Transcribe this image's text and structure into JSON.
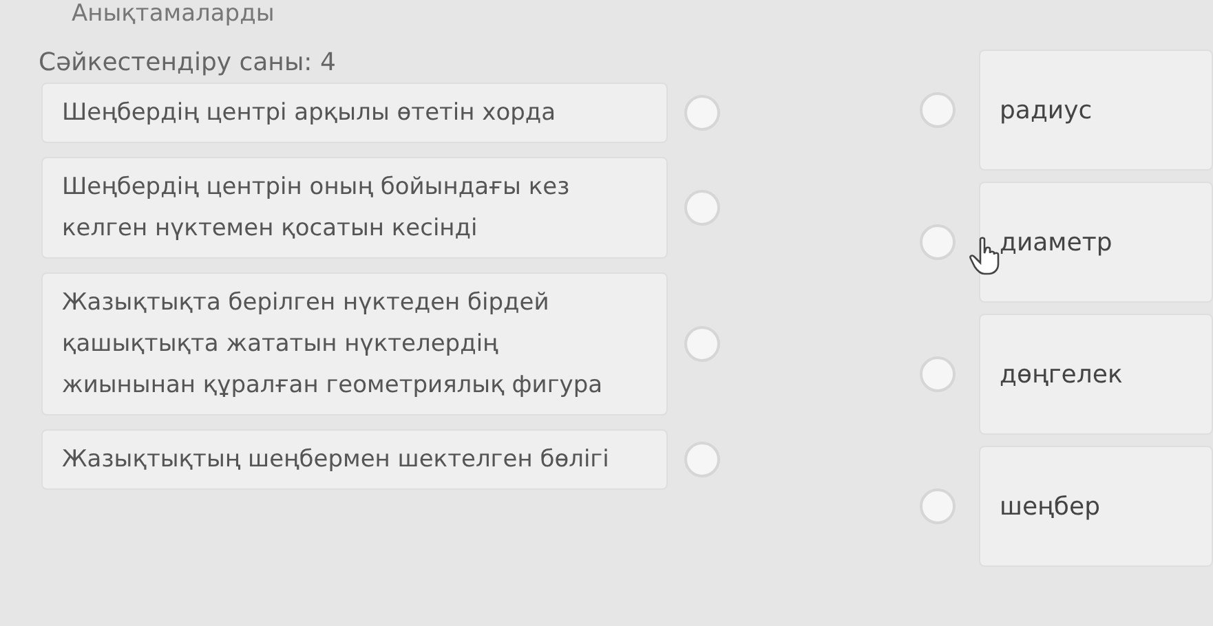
{
  "heading": "Анықтамаларды",
  "count_label": "Сәйкестендіру саны: 4",
  "left_items": [
    {
      "text": "Шеңбердің центрі арқылы өтетін хорда"
    },
    {
      "text": "Шеңбердің центрін оның бойындағы кез келген нүктемен қосатын кесінді"
    },
    {
      "text": "Жазықтықта берілген нүктеден бірдей қашықтықта жататын нүктелердің жиынынан құралған геометриялық фигура"
    },
    {
      "text": "Жазықтықтың шеңбермен шектелген бөлігі"
    }
  ],
  "right_items": [
    {
      "text": "радиус"
    },
    {
      "text": "диаметр"
    },
    {
      "text": "дөңгелек"
    },
    {
      "text": "шеңбер"
    }
  ]
}
